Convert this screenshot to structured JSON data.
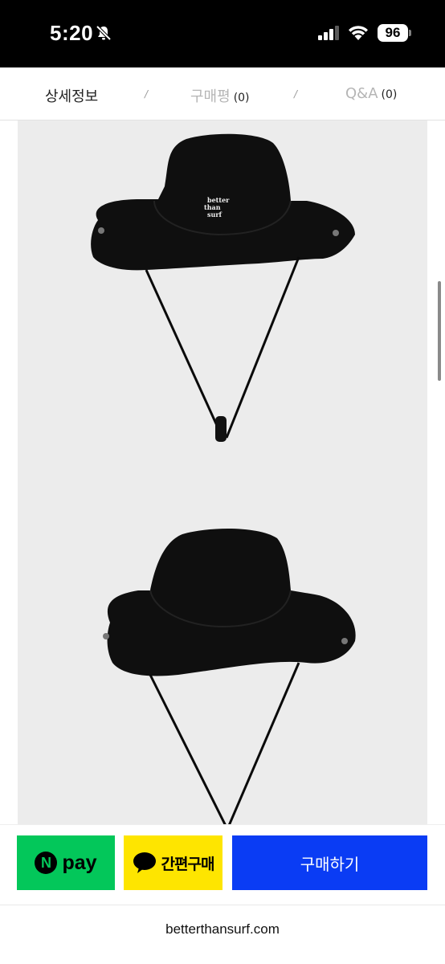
{
  "status_bar": {
    "time": "5:20",
    "battery": "96"
  },
  "tabs": [
    {
      "label": "상세정보",
      "count": ""
    },
    {
      "label": "구매평",
      "count": "(0)"
    },
    {
      "label": "Q&A",
      "count": "(0)"
    }
  ],
  "tab_separator": "/",
  "product_images": [
    {
      "embroidery": [
        "better",
        "than",
        "surf"
      ]
    },
    {
      "embroidery": []
    }
  ],
  "buy_bar": {
    "npay_label": "pay",
    "npay_badge": "N",
    "kakao_label": "간편구매",
    "buy_label": "구매하기"
  },
  "browser": {
    "url": "betterthansurf.com"
  },
  "colors": {
    "npay": "#03c75a",
    "kakao": "#fee500",
    "buy": "#0a3cf4",
    "image_bg": "#ececec"
  }
}
